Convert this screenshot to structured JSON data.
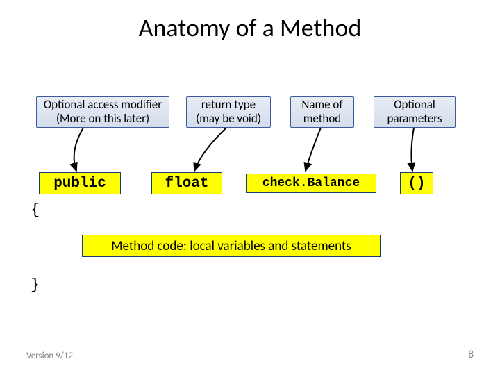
{
  "title": "Anatomy of a Method",
  "labels": {
    "access": {
      "line1": "Optional access modifier",
      "line2": "(More on this later)"
    },
    "return": {
      "line1": "return type",
      "line2": "(may be void)"
    },
    "name": {
      "line1": "Name of",
      "line2": "method"
    },
    "params": {
      "line1": "Optional",
      "line2": "parameters"
    }
  },
  "tokens": {
    "public": "public",
    "float": "float",
    "check": "check.Balance",
    "parens": "()"
  },
  "braces": {
    "open": "{",
    "close": "}"
  },
  "body": "Method code: local variables and statements",
  "footer": {
    "version": "Version 9/12",
    "page": "8"
  }
}
